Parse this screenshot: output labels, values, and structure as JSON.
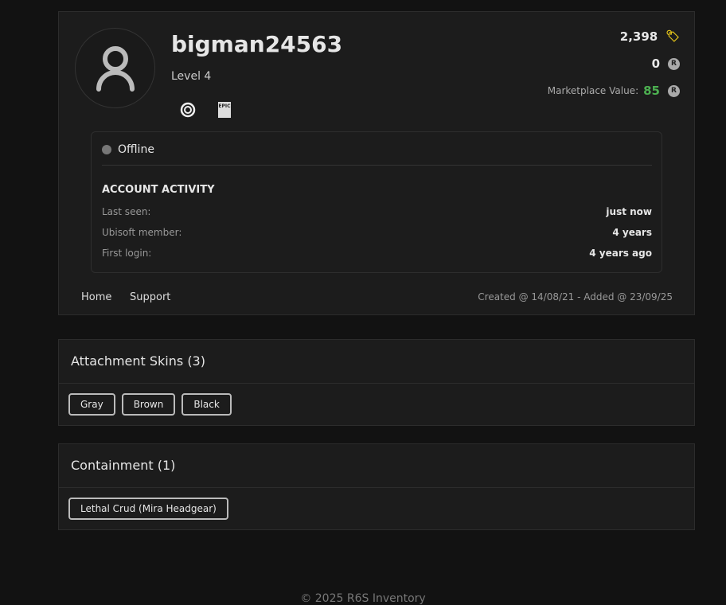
{
  "profile": {
    "username": "bigman24563",
    "level": "Level 4",
    "platforms": [
      "ubisoft",
      "epic"
    ],
    "credits": "2,398",
    "renown": "0",
    "marketplace_label": "Marketplace Value:",
    "marketplace_value": "85",
    "status": "Offline",
    "activity_title": "ACCOUNT ACTIVITY",
    "activity": [
      {
        "label": "Last seen:",
        "value": "just now"
      },
      {
        "label": "Ubisoft member:",
        "value": "4 years"
      },
      {
        "label": "First login:",
        "value": "4 years ago"
      }
    ],
    "nav": [
      "Home",
      "Support"
    ],
    "created": "Created @ 14/08/21 - Added @ 23/09/25",
    "epic_text": "EPIC"
  },
  "sections": [
    {
      "title": "Attachment Skins (3)",
      "items": [
        "Gray",
        "Brown",
        "Black"
      ]
    },
    {
      "title": "Containment (1)",
      "items": [
        "Lethal Crud (Mira Headgear)"
      ]
    }
  ],
  "footer": "© 2025 R6S Inventory",
  "colors": {
    "green": "#4caf50",
    "gold": "#e6c619"
  }
}
